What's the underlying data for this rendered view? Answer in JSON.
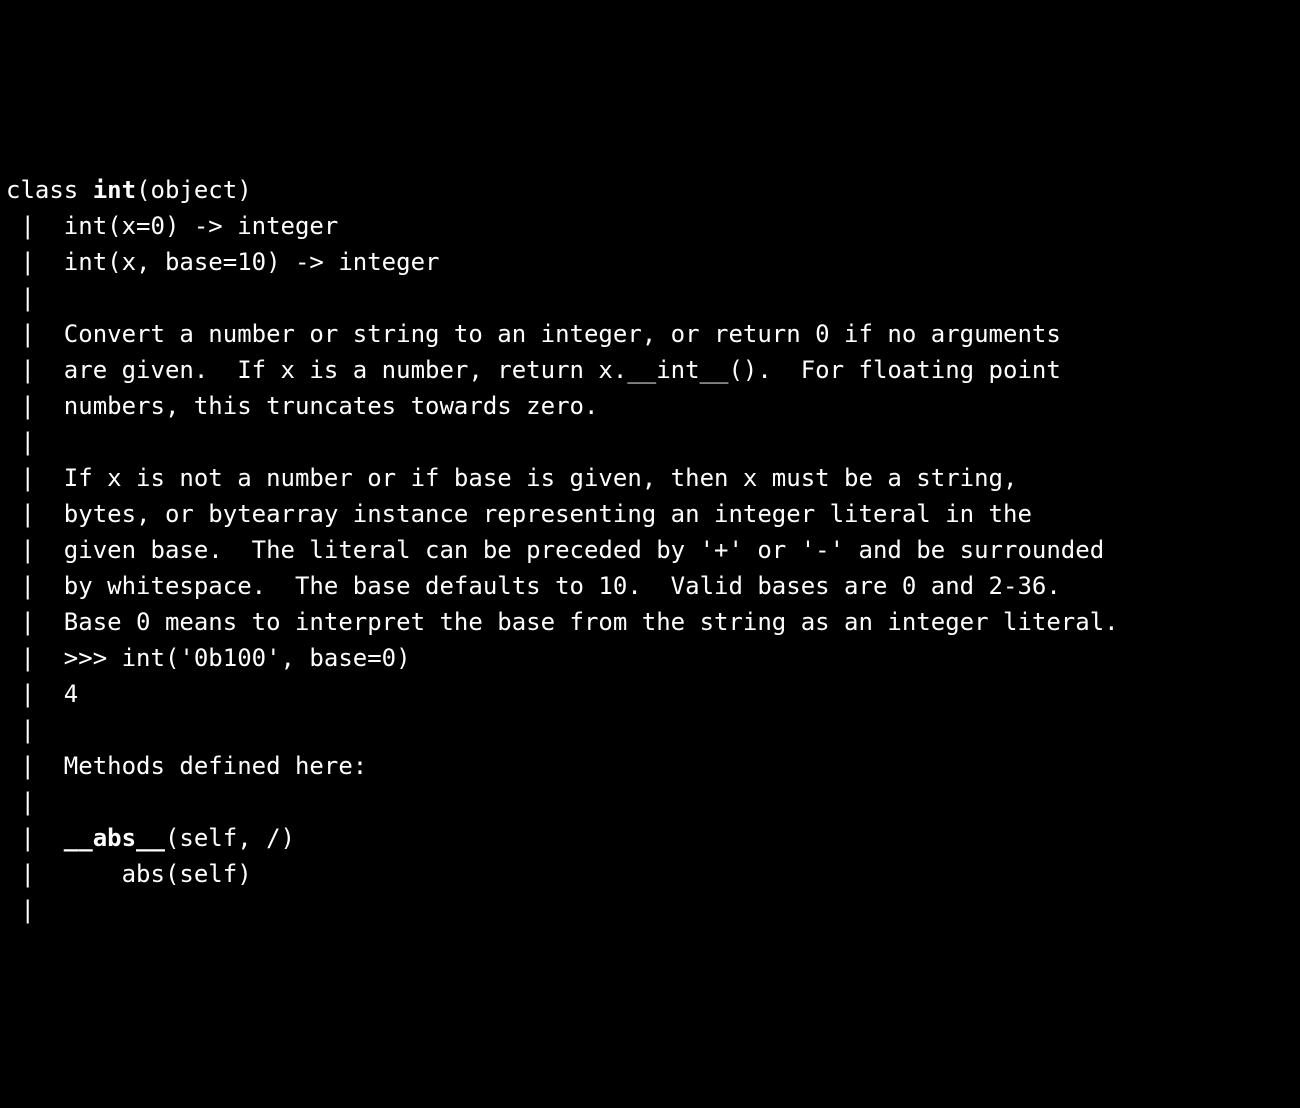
{
  "help": {
    "l0_pre": "class ",
    "l0_bold": "int",
    "l0_post": "(object)",
    "l1": " |  int(x=0) -> integer",
    "l2": " |  int(x, base=10) -> integer",
    "l3": " |  ",
    "l4": " |  Convert a number or string to an integer, or return 0 if no arguments",
    "l5": " |  are given.  If x is a number, return x.__int__().  For floating point",
    "l6": " |  numbers, this truncates towards zero.",
    "l7": " |  ",
    "l8": " |  If x is not a number or if base is given, then x must be a string,",
    "l9": " |  bytes, or bytearray instance representing an integer literal in the",
    "l10": " |  given base.  The literal can be preceded by '+' or '-' and be surrounded",
    "l11": " |  by whitespace.  The base defaults to 10.  Valid bases are 0 and 2-36.",
    "l12": " |  Base 0 means to interpret the base from the string as an integer literal.",
    "l13": " |  >>> int('0b100', base=0)",
    "l14": " |  4",
    "l15": " |  ",
    "l16": " |  Methods defined here:",
    "l17": " |  ",
    "l18_pre": " |  ",
    "l18_bold": "__abs__",
    "l18_post": "(self, /)",
    "l19": " |      abs(self)",
    "l20": " |  "
  }
}
